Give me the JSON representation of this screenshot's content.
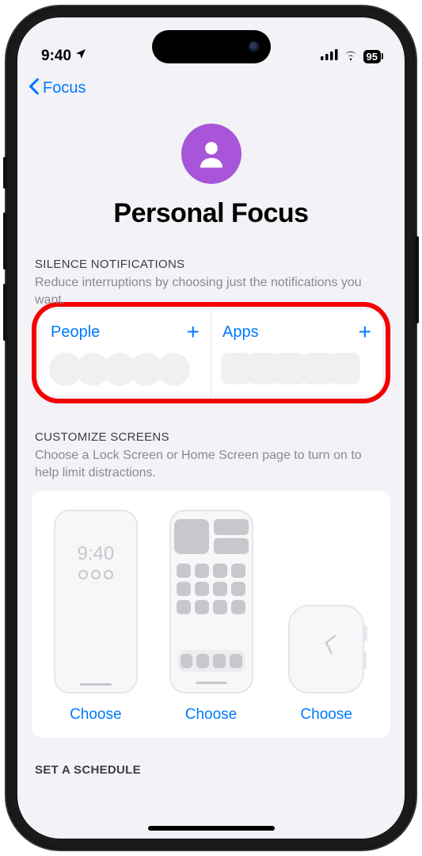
{
  "status": {
    "time": "9:40",
    "battery": "95"
  },
  "nav": {
    "back_label": "Focus"
  },
  "hero": {
    "title": "Personal Focus"
  },
  "silence": {
    "label": "SILENCE NOTIFICATIONS",
    "sub": "Reduce interruptions by choosing just the notifications you want.",
    "people_label": "People",
    "apps_label": "Apps"
  },
  "customize": {
    "label": "CUSTOMIZE SCREENS",
    "sub": "Choose a Lock Screen or Home Screen page to turn on to help limit distractions.",
    "lock_time": "9:40",
    "choose_label": "Choose"
  },
  "schedule": {
    "label": "SET A SCHEDULE"
  }
}
